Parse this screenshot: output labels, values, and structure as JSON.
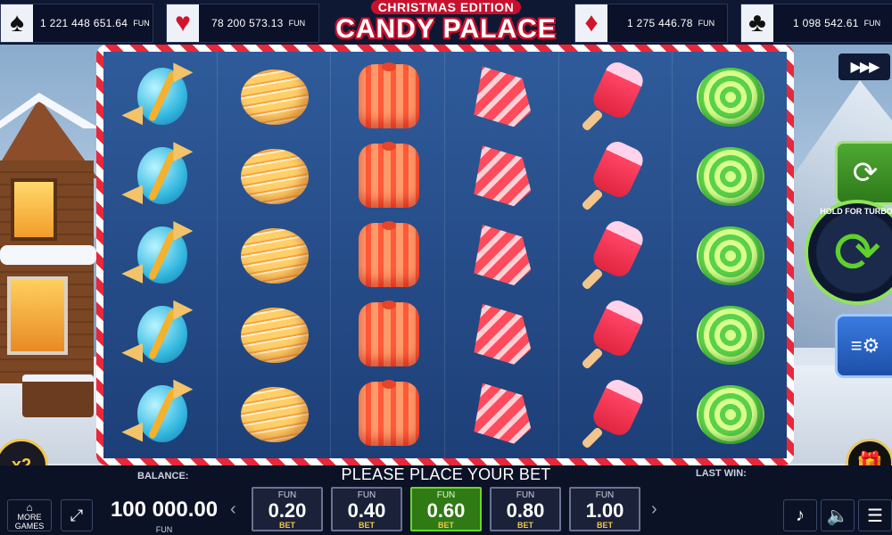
{
  "jackpots": [
    {
      "suit": "♠",
      "value": "1 221 448 651.64",
      "currency": "FUN",
      "suit_color": "#111111"
    },
    {
      "suit": "♥",
      "value": "78 200 573.13",
      "currency": "FUN",
      "suit_color": "#d0142c"
    },
    {
      "suit": "♦",
      "value": "1 275 446.78",
      "currency": "FUN",
      "suit_color": "#d0142c"
    },
    {
      "suit": "♣",
      "value": "1 098 542.61",
      "currency": "FUN",
      "suit_color": "#111111"
    }
  ],
  "logo": {
    "subtitle": "CHRISTMAS EDITION",
    "title": "CANDY PALACE"
  },
  "reels": [
    [
      "blue-wrapped-candy",
      "blue-wrapped-candy",
      "blue-wrapped-candy",
      "blue-wrapped-candy",
      "blue-wrapped-candy"
    ],
    [
      "orange-macaron",
      "orange-macaron",
      "orange-macaron",
      "orange-macaron",
      "orange-macaron"
    ],
    [
      "orange-jelly-cake",
      "orange-jelly-cake",
      "orange-jelly-cake",
      "orange-jelly-cake",
      "orange-jelly-cake"
    ],
    [
      "red-ribbon-candy",
      "red-ribbon-candy",
      "red-ribbon-candy",
      "red-ribbon-candy",
      "red-ribbon-candy"
    ],
    [
      "red-popsicle",
      "red-popsicle",
      "red-popsicle",
      "red-popsicle",
      "red-popsicle"
    ],
    [
      "green-swirl-candy",
      "green-swirl-candy",
      "green-swirl-candy",
      "green-swirl-candy",
      "green-swirl-candy"
    ]
  ],
  "controls": {
    "fast_forward": "▶▶▶",
    "autoplay_icon": "⟳",
    "spin_icon": "⟳",
    "turbo_label": "HOLD FOR TURBO",
    "settings_icon": "≡⚙",
    "multiplier": "x2",
    "gift_icon": "🎁"
  },
  "bottom": {
    "message": "PLEASE PLACE YOUR BET",
    "balance_label": "BALANCE:",
    "balance_value": "100 000.00",
    "balance_currency": "FUN",
    "last_win_label": "LAST WIN:",
    "more_games_label": "MORE GAMES",
    "more_games_icon": "⌂",
    "fullscreen_icon": "⤢",
    "arrow_left": "‹",
    "arrow_right": "›",
    "bets": [
      {
        "currency": "FUN",
        "value": "0.20",
        "label": "BET",
        "active": false
      },
      {
        "currency": "FUN",
        "value": "0.40",
        "label": "BET",
        "active": false
      },
      {
        "currency": "FUN",
        "value": "0.60",
        "label": "BET",
        "active": true
      },
      {
        "currency": "FUN",
        "value": "0.80",
        "label": "BET",
        "active": false
      },
      {
        "currency": "FUN",
        "value": "1.00",
        "label": "BET",
        "active": false
      }
    ],
    "music_icon": "♪",
    "sound_icon": "🔈",
    "menu_icon": "☰"
  },
  "colors": {
    "accent_green": "#6ad52f",
    "frame_red": "#e8283a",
    "gold": "#f2c84b"
  }
}
